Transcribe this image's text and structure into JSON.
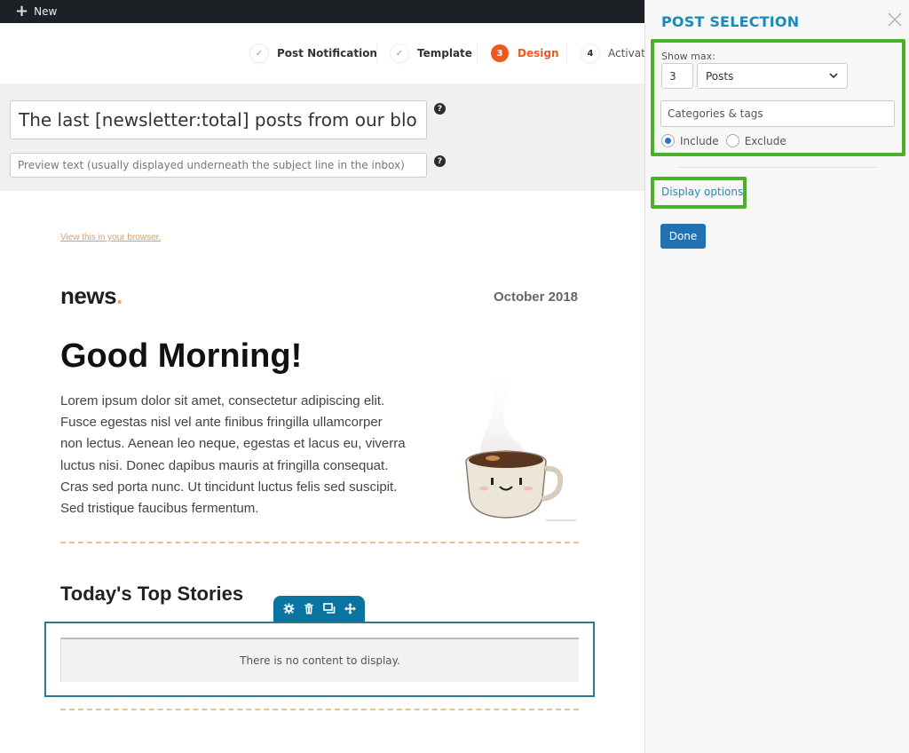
{
  "adminbar": {
    "new_label": "New",
    "new_icon": "plus-icon"
  },
  "steps": [
    {
      "label": "Post Notification",
      "marker": "✓",
      "state": "done"
    },
    {
      "label": "Template",
      "marker": "✓",
      "state": "done"
    },
    {
      "label": "Design",
      "marker": "3",
      "state": "active"
    },
    {
      "label": "Activate",
      "marker": "4",
      "state": "future"
    }
  ],
  "subject": {
    "value": "The last [newsletter:total] posts from our blog",
    "help_icon": "question-icon"
  },
  "preview": {
    "value": "",
    "placeholder": "Preview text (usually displayed underneath the subject line in the inbox)",
    "help_icon": "question-icon"
  },
  "email": {
    "view_in_browser": "View this in your browser.",
    "logo_text": "news",
    "logo_dot": ".",
    "date": "October 2018",
    "headline": "Good Morning!",
    "body": "Lorem ipsum dolor sit amet, consectetur adipiscing elit. Fusce egestas nisl vel ante finibus fringilla ullamcorper non lectus. Aenean leo neque, egestas et lacus eu, viverra luctus nisi. Donec dapibus mauris at fringilla consequat. Cras sed porta nunc. Ut tincidunt luctus felis sed suscipit. Sed tristique faucibus fermentum.",
    "image_alt": "coffee-cup-illustration",
    "section_title": "Today's Top Stories",
    "block_toolbar": [
      "gear-icon",
      "trash-icon",
      "duplicate-icon",
      "move-icon"
    ],
    "empty_message": "There is no content to display."
  },
  "panel": {
    "title": "POST SELECTION",
    "close_icon": "close-icon",
    "show_max_label": "Show max:",
    "show_max_value": "3",
    "post_type_selected": "Posts",
    "categories_placeholder": "Categories & tags",
    "radio_options": [
      {
        "label": "Include",
        "checked": true
      },
      {
        "label": "Exclude",
        "checked": false
      }
    ],
    "display_options_label": "Display options",
    "done_label": "Done"
  },
  "colors": {
    "accent_orange": "#ee5a1e",
    "panel_title_blue": "#1a8ab8",
    "highlight_green": "#4caf2a",
    "done_button": "#2271b1",
    "block_toolbar": "#0a74a1",
    "divider_dashed": "#e8c08e"
  }
}
